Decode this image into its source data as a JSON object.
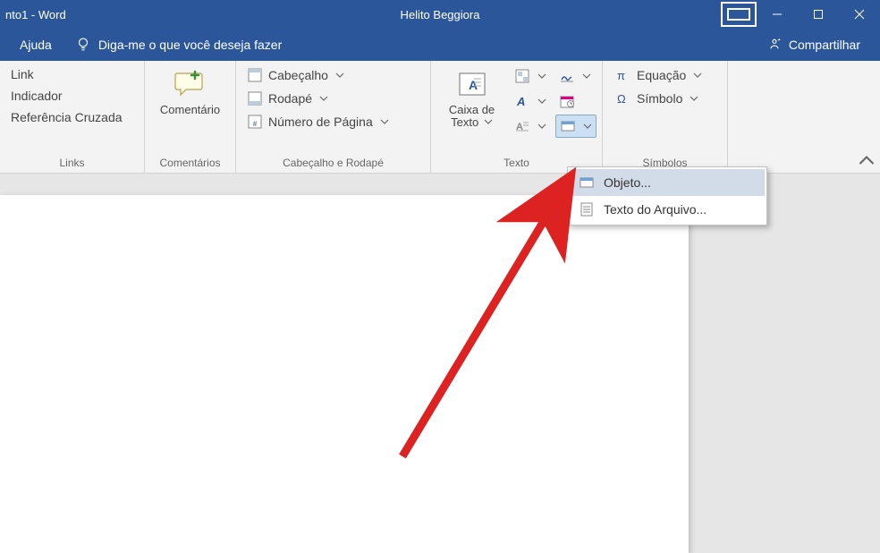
{
  "title_bar": {
    "doc_title": "nto1  -  Word",
    "user_name": "Helito Beggiora"
  },
  "ribbon_tabs": {
    "help": "Ajuda",
    "tell_me_placeholder": "Diga-me o que você deseja fazer",
    "share": "Compartilhar"
  },
  "groups": {
    "links": {
      "label": "Links",
      "link": "Link",
      "bookmark": "Indicador",
      "cross_ref": "Referência Cruzada"
    },
    "comments": {
      "label": "Comentários",
      "comment": "Comentário"
    },
    "header_footer": {
      "label": "Cabeçalho e Rodapé",
      "header": "Cabeçalho",
      "footer": "Rodapé",
      "page_number": "Número de Página"
    },
    "text": {
      "label": "Texto",
      "text_box": "Caixa de Texto"
    },
    "symbols": {
      "label": "Símbolos",
      "equation": "Equação",
      "symbol": "Símbolo"
    }
  },
  "dropdown": {
    "object": "Objeto...",
    "text_from_file": "Texto do Arquivo..."
  }
}
